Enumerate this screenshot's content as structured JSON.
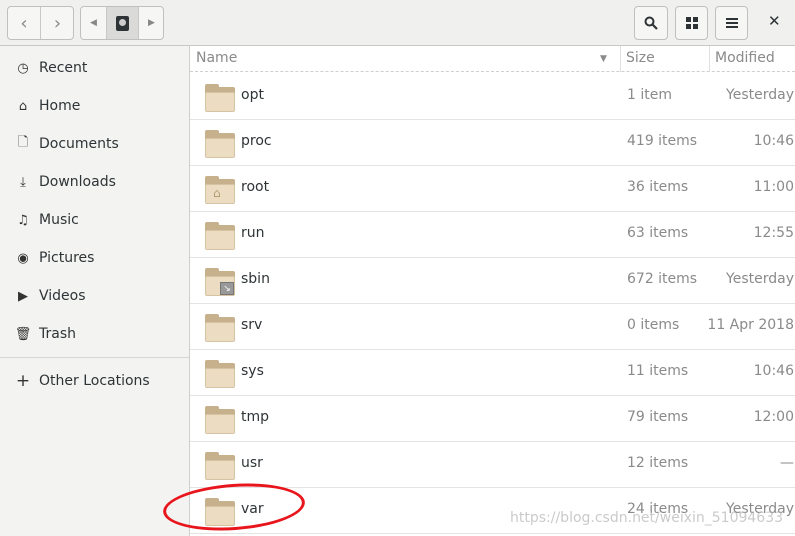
{
  "toolbar": {
    "back": "back-button",
    "forward": "forward-button",
    "path_label": "/",
    "search": "search",
    "view": "grid-view",
    "menu": "menu",
    "close": "close"
  },
  "sidebar": {
    "items": [
      {
        "label": "Recent",
        "icon": "clock-icon"
      },
      {
        "label": "Home",
        "icon": "home-icon"
      },
      {
        "label": "Documents",
        "icon": "document-icon"
      },
      {
        "label": "Downloads",
        "icon": "download-icon"
      },
      {
        "label": "Music",
        "icon": "music-icon"
      },
      {
        "label": "Pictures",
        "icon": "camera-icon"
      },
      {
        "label": "Videos",
        "icon": "video-icon"
      },
      {
        "label": "Trash",
        "icon": "trash-icon"
      }
    ],
    "other": "Other Locations"
  },
  "columns": {
    "name": "Name",
    "size": "Size",
    "modified": "Modified"
  },
  "files": [
    {
      "name": "opt",
      "size": "1 item",
      "modified": "Yesterday",
      "type": "folder"
    },
    {
      "name": "proc",
      "size": "419 items",
      "modified": "10:46",
      "type": "folder"
    },
    {
      "name": "root",
      "size": "36 items",
      "modified": "11:00",
      "type": "home-folder"
    },
    {
      "name": "run",
      "size": "63 items",
      "modified": "12:55",
      "type": "folder"
    },
    {
      "name": "sbin",
      "size": "672 items",
      "modified": "Yesterday",
      "type": "symlink-folder"
    },
    {
      "name": "srv",
      "size": "0 items",
      "modified": "11 Apr 2018",
      "type": "folder"
    },
    {
      "name": "sys",
      "size": "11 items",
      "modified": "10:46",
      "type": "folder"
    },
    {
      "name": "tmp",
      "size": "79 items",
      "modified": "12:00",
      "type": "folder"
    },
    {
      "name": "usr",
      "size": "12 items",
      "modified": "—",
      "type": "folder"
    },
    {
      "name": "var",
      "size": "24 items",
      "modified": "Yesterday",
      "type": "folder"
    }
  ],
  "annotation_color": "#e8161c",
  "watermark": "https://blog.csdn.net/weixin_51094633"
}
